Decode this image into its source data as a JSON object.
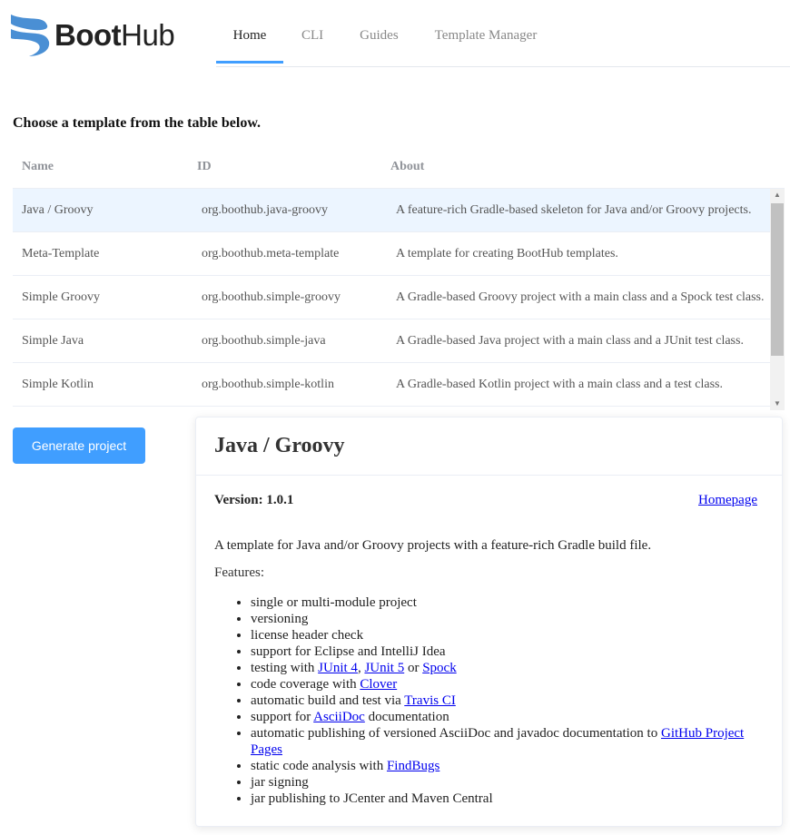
{
  "brand": {
    "logo_text_bold": "Boot",
    "logo_text_light": "Hub",
    "logo_color": "#4a8fd4"
  },
  "nav": {
    "tabs": [
      {
        "label": "Home",
        "active": true
      },
      {
        "label": "CLI"
      },
      {
        "label": "Guides"
      },
      {
        "label": "Template Manager"
      }
    ]
  },
  "prompt": "Choose a template from the table below.",
  "table": {
    "headers": [
      "Name",
      "ID",
      "About"
    ],
    "rows": [
      [
        "Java / Groovy",
        "org.boothub.java-groovy",
        "A feature-rich Gradle-based skeleton for Java and/or Groovy projects."
      ],
      [
        "Meta-Template",
        "org.boothub.meta-template",
        "A template for creating BootHub templates."
      ],
      [
        "Simple Groovy",
        "org.boothub.simple-groovy",
        "A Gradle-based Groovy project with a main class and a Spock test class."
      ],
      [
        "Simple Java",
        "org.boothub.simple-java",
        "A Gradle-based Java project with a main class and a JUnit test class."
      ],
      [
        "Simple Kotlin",
        "org.boothub.simple-kotlin",
        "A Gradle-based Kotlin project with a main class and a test class."
      ]
    ],
    "selected_index": 0
  },
  "generate_label": "Generate project",
  "detail": {
    "title": "Java / Groovy",
    "version": "Version: 1.0.1",
    "homepage": "Homepage",
    "description": "A template for Java and/or Groovy projects with a feature-rich Gradle build file.",
    "features_label": "Features:",
    "features": [
      [
        {
          "t": "single or multi-module project"
        }
      ],
      [
        {
          "t": "versioning"
        }
      ],
      [
        {
          "t": "license header check"
        }
      ],
      [
        {
          "t": "support for Eclipse and IntelliJ Idea"
        }
      ],
      [
        {
          "t": "testing with "
        },
        {
          "t": "JUnit 4",
          "link": true
        },
        {
          "t": ", "
        },
        {
          "t": "JUnit 5",
          "link": true
        },
        {
          "t": " or "
        },
        {
          "t": "Spock",
          "link": true
        }
      ],
      [
        {
          "t": "code coverage with "
        },
        {
          "t": "Clover",
          "link": true
        }
      ],
      [
        {
          "t": "automatic build and test via "
        },
        {
          "t": "Travis CI",
          "link": true
        }
      ],
      [
        {
          "t": "support for "
        },
        {
          "t": "AsciiDoc",
          "link": true
        },
        {
          "t": " documentation"
        }
      ],
      [
        {
          "t": "automatic publishing of versioned AsciiDoc and javadoc documentation to "
        },
        {
          "t": "GitHub Project Pages",
          "link": true
        }
      ],
      [
        {
          "t": "static code analysis with "
        },
        {
          "t": "FindBugs",
          "link": true
        }
      ],
      [
        {
          "t": "jar signing"
        }
      ],
      [
        {
          "t": "jar publishing to JCenter and Maven Central"
        }
      ]
    ]
  }
}
